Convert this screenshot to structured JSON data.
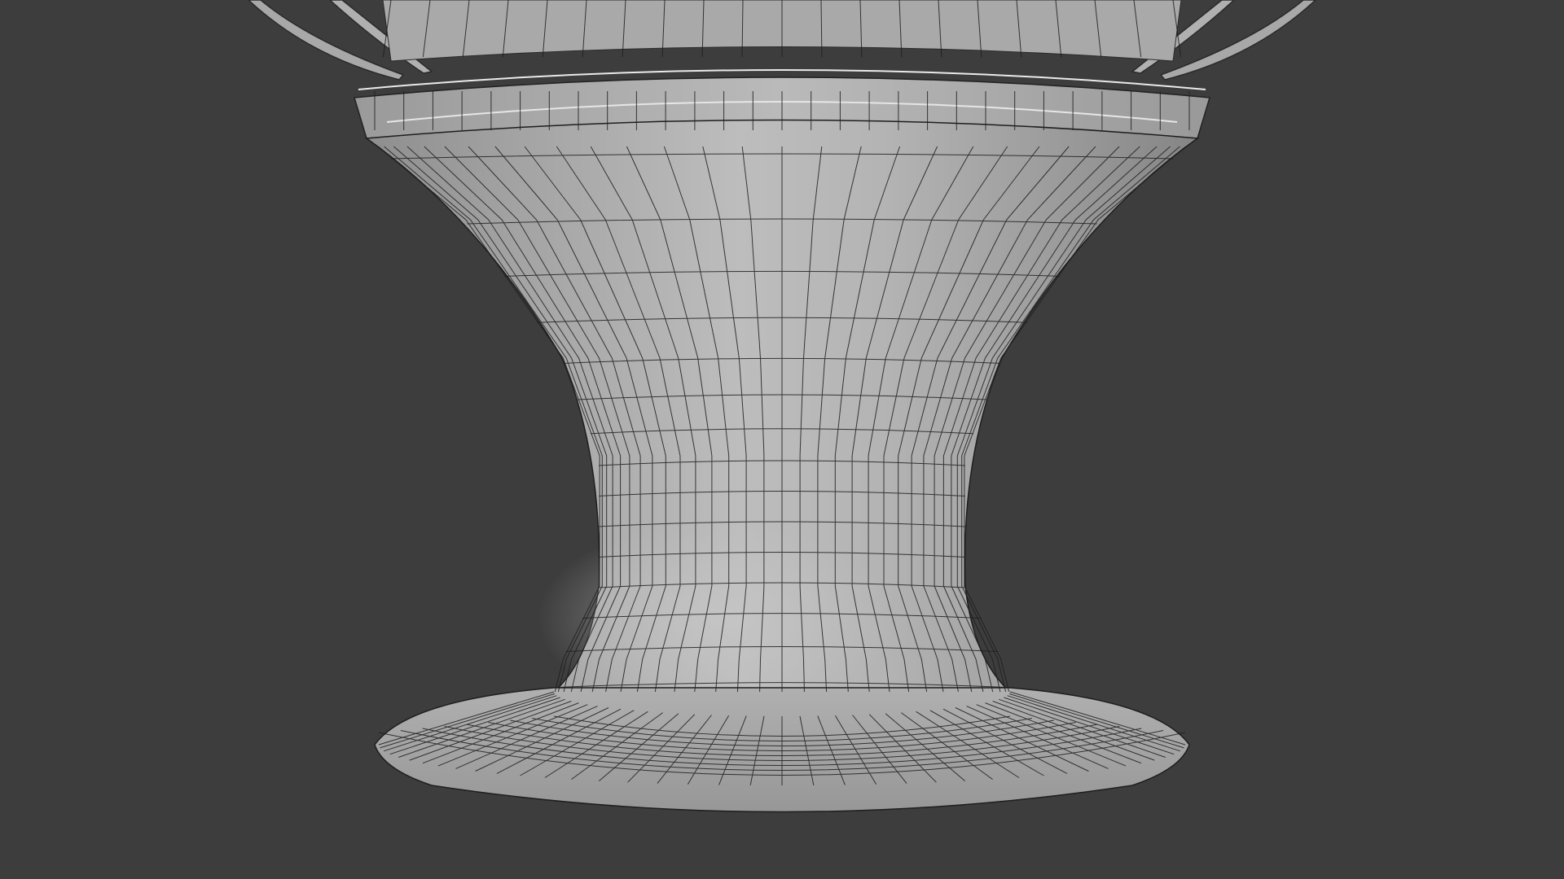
{
  "viewport": {
    "background_color": "#3d3d3d",
    "shading": "solid",
    "overlay": "wireframe"
  },
  "model": {
    "object": "vase-pedestal",
    "surface_color": "#b4b4b4",
    "wire_color": "#1e1e1e"
  }
}
